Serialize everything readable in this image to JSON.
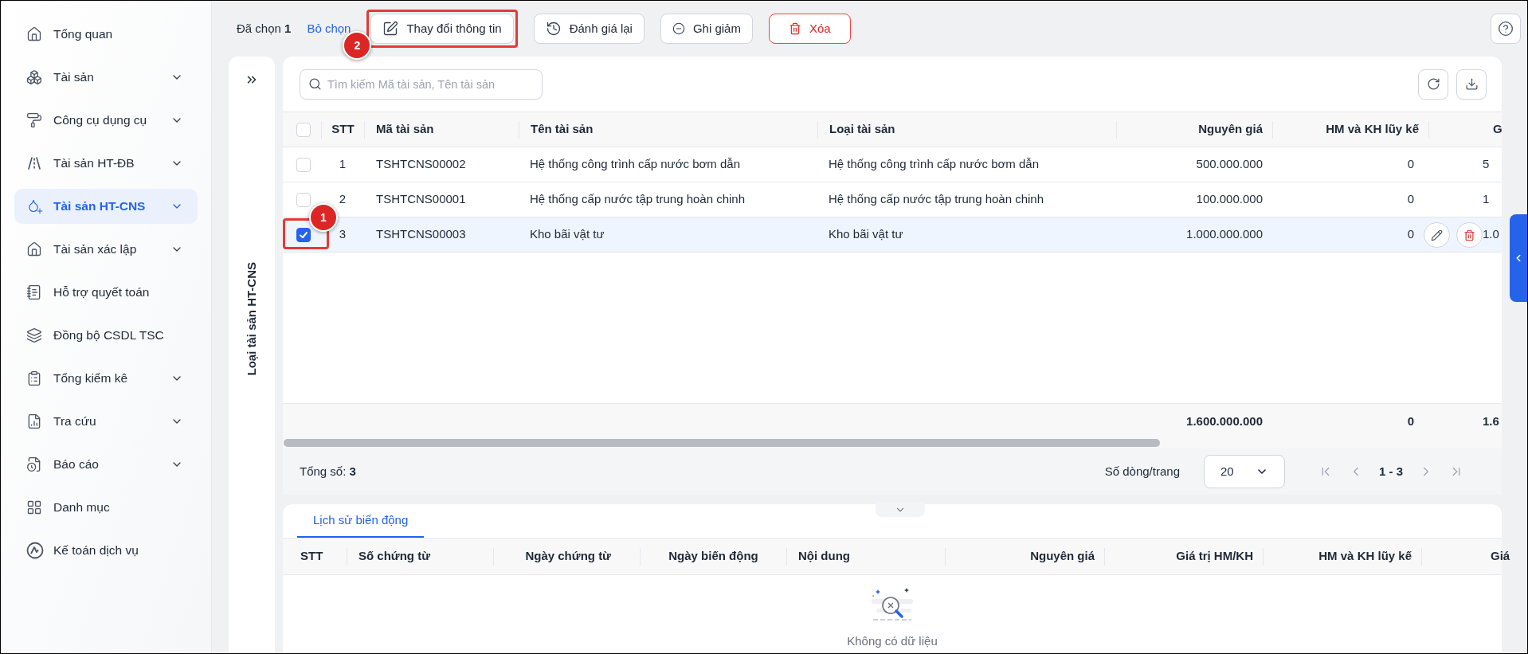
{
  "sidebar": {
    "items": [
      {
        "label": "Tổng quan",
        "has_submenu": false,
        "selected": false
      },
      {
        "label": "Tài sản",
        "has_submenu": true,
        "selected": false
      },
      {
        "label": "Công cụ dụng cụ",
        "has_submenu": true,
        "selected": false
      },
      {
        "label": "Tài sản HT-ĐB",
        "has_submenu": true,
        "selected": false
      },
      {
        "label": "Tài sản HT-CNS",
        "has_submenu": true,
        "selected": true
      },
      {
        "label": "Tài sản xác lập",
        "has_submenu": true,
        "selected": false
      },
      {
        "label": "Hỗ trợ quyết toán",
        "has_submenu": false,
        "selected": false
      },
      {
        "label": "Đồng bộ CSDL TSC",
        "has_submenu": false,
        "selected": false
      },
      {
        "label": "Tổng kiểm kê",
        "has_submenu": true,
        "selected": false
      },
      {
        "label": "Tra cứu",
        "has_submenu": true,
        "selected": false
      },
      {
        "label": "Báo cáo",
        "has_submenu": true,
        "selected": false
      },
      {
        "label": "Danh mục",
        "has_submenu": false,
        "selected": false
      },
      {
        "label": "Kế toán dịch vụ",
        "has_submenu": false,
        "selected": false
      }
    ]
  },
  "toolbar": {
    "selection": "Đã chọn **1**",
    "clear_link": "Bỏ chọn",
    "buttons": [
      {
        "label": "Thay đổi thông tin",
        "kind": "edit",
        "annotation": "2"
      },
      {
        "label": "Đánh giá lại",
        "kind": "revalue"
      },
      {
        "label": "Ghi giảm",
        "kind": "decrease"
      },
      {
        "label": "Xóa",
        "kind": "delete"
      }
    ]
  },
  "side_panel": {
    "label": "Loại tài sản HT-CNS"
  },
  "search": {
    "placeholder": "Tìm kiếm Mã tài sản, Tên tài sản"
  },
  "table": {
    "header_checked": false,
    "columns": [
      "STT",
      "Mã tài sản",
      "Tên tài sản",
      "Loại tài sản",
      "Nguyên giá",
      "HM và KH lũy kế",
      "G"
    ],
    "rows": [
      {
        "checked": false,
        "selected": false,
        "hovered": false,
        "stt": "1",
        "code": "TSHTCNS00002",
        "name": "Hệ thống công trình cấp nước bơm dẫn",
        "type": "Hệ thống công trình cấp nước bơm dẫn",
        "cost": "500.000.000",
        "accumulated": "0",
        "column_7": "5"
      },
      {
        "checked": false,
        "selected": false,
        "hovered": false,
        "stt": "2",
        "code": "TSHTCNS00001",
        "name": "Hệ thống cấp nước tập trung hoàn chinh",
        "type": "Hệ thống cấp nước tập trung hoàn chinh",
        "cost": "100.000.000",
        "accumulated": "0",
        "column_7": "1"
      },
      {
        "checked": true,
        "selected": true,
        "hovered": true,
        "annotation": "1",
        "stt": "3",
        "code": "TSHTCNS00003",
        "name": "Kho bãi vật tư",
        "type": "Kho bãi vật tư",
        "cost": "1.000.000.000",
        "accumulated": "0",
        "column_7": "1.0"
      }
    ],
    "totals": {
      "cost": "1.600.000.000",
      "accumulated": "0",
      "column_7": "1.6"
    }
  },
  "pagination": {
    "total": "Tổng số: **3**",
    "rows_per_page_label": "Số dòng/trang",
    "rows_per_page": "20",
    "range": "1 - 3"
  },
  "history": {
    "tabs": [
      {
        "label": "Lịch sử biến động",
        "selected": true
      }
    ],
    "columns": [
      "STT",
      "Số chứng từ",
      "Ngày chứng từ",
      "Ngày biến động",
      "Nội dung",
      "Nguyên giá",
      "Giá trị HM/KH",
      "HM và KH lũy kế",
      "Giá"
    ],
    "empty_text": "Không có dữ liệu"
  }
}
